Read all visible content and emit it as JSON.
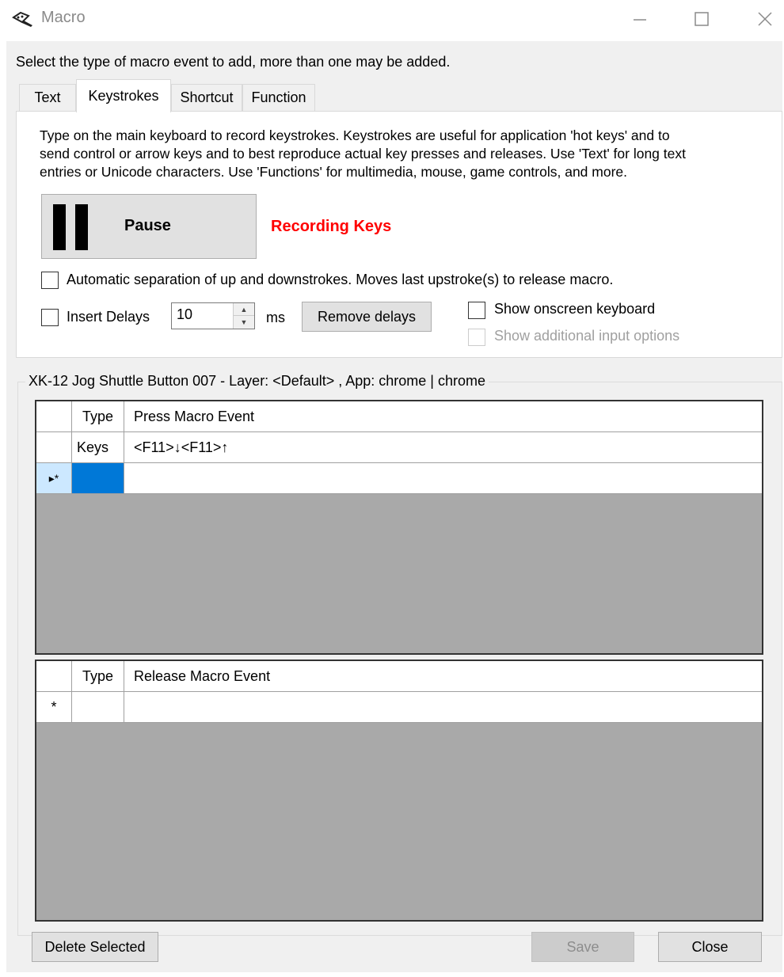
{
  "window": {
    "title": "Macro",
    "icon": "keyboard-pen-icon",
    "controls": [
      "minimize-icon",
      "maximize-icon",
      "close-icon"
    ]
  },
  "instruction": "Select the type of macro event to add, more than one may be added.",
  "tabs": [
    {
      "label": "Text",
      "active": false
    },
    {
      "label": "Keystrokes",
      "active": true
    },
    {
      "label": "Shortcut",
      "active": false
    },
    {
      "label": "Function",
      "active": false
    }
  ],
  "keystrokes": {
    "description_lines": [
      "Type on the main keyboard to record keystrokes. Keystrokes are useful for application 'hot keys' and to",
      "send control or arrow keys and to best reproduce actual key presses and releases. Use 'Text' for long text",
      "entries or Unicode characters. Use 'Functions' for multimedia, mouse, game controls, and more."
    ],
    "pause_label": "Pause",
    "recording_status": "Recording Keys",
    "auto_separation_label": "Automatic separation of up and downstrokes. Moves last upstroke(s) to release macro.",
    "insert_delays_label": "Insert Delays",
    "delay_value": "10",
    "delay_unit": "ms",
    "remove_delays_label": "Remove delays",
    "show_keyboard_label": "Show onscreen keyboard",
    "show_additional_label": "Show additional input options"
  },
  "group": {
    "title": "XK-12 Jog Shuttle Button 007 - Layer: <Default> , App: chrome | chrome"
  },
  "press_grid": {
    "headers": {
      "type": "Type",
      "event": "Press Macro Event"
    },
    "rows": [
      {
        "indicator": "",
        "type": "Keys",
        "event": "<F11>↓<F11>↑"
      }
    ],
    "new_row_indicator": "▸*"
  },
  "release_grid": {
    "headers": {
      "type": "Type",
      "event": "Release Macro Event"
    },
    "new_row_indicator": "*"
  },
  "buttons": {
    "delete_selected": "Delete Selected",
    "save": "Save",
    "close": "Close"
  },
  "colors": {
    "recording": "#ff0000",
    "selection": "#0078d7",
    "grid_background": "#a9a9a9",
    "window_background": "#f0f0f0"
  }
}
